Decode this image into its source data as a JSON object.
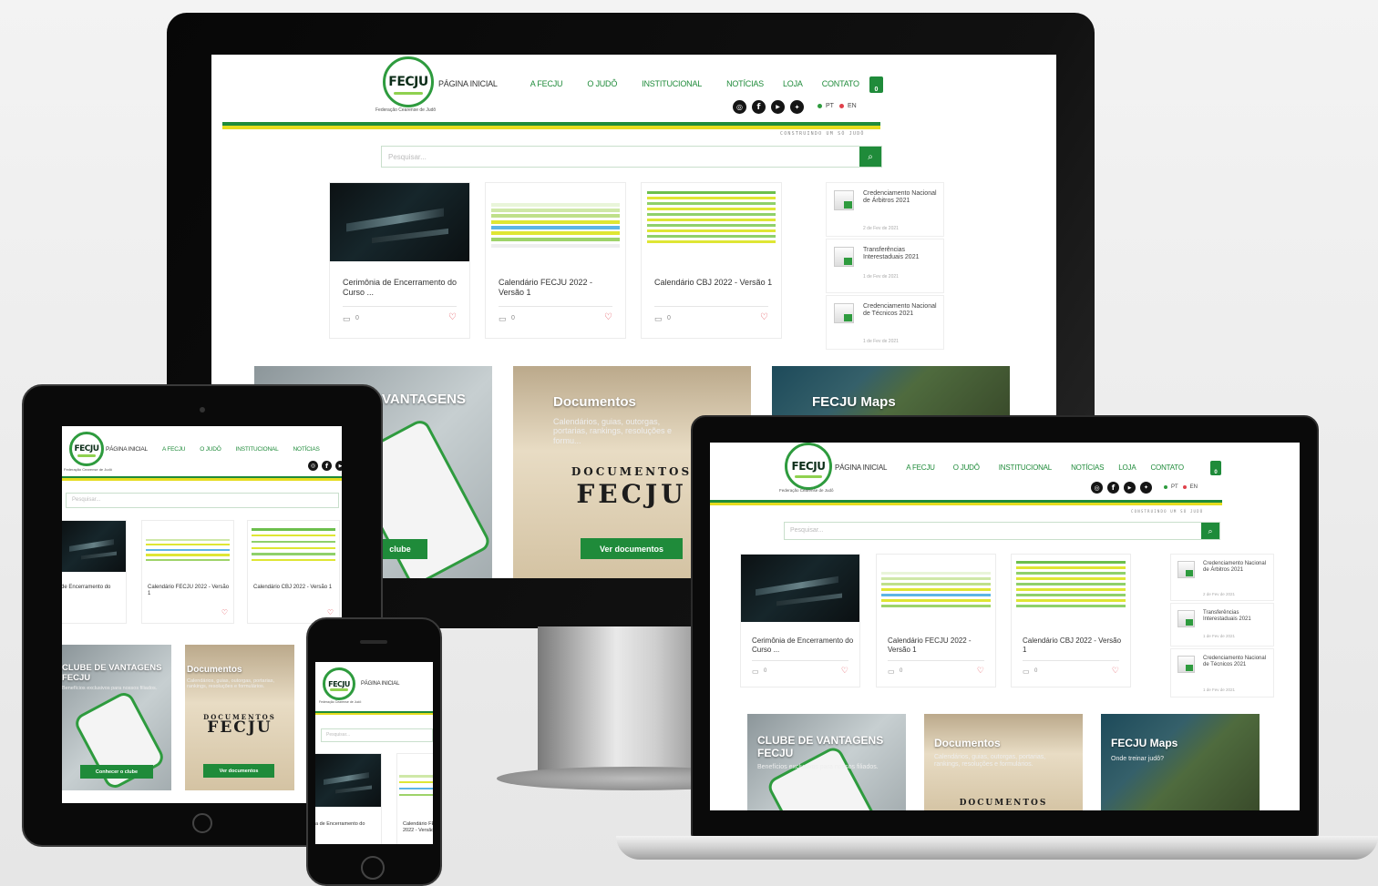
{
  "site": {
    "logo_text": "FECJU",
    "federation_name": "Federação Cearense de Judô",
    "nav": [
      "PÁGINA INICIAL",
      "A FECJU",
      "O JUDÔ",
      "INSTITUCIONAL",
      "NOTÍCIAS",
      "LOJA",
      "CONTATO"
    ],
    "cart_count": "0",
    "social_icons": [
      "instagram-icon",
      "facebook-icon",
      "youtube-icon",
      "twitter-icon"
    ],
    "languages": [
      {
        "code": "PT",
        "color": "#2e9b3e"
      },
      {
        "code": "EN",
        "color": "#e0414b"
      }
    ],
    "tagline": "CONSTRUINDO UM SÓ JUDÔ",
    "search_placeholder": "Pesquisar...",
    "posts": [
      {
        "title": "Cerimônia de Encerramento do Curso ...",
        "comments": "0"
      },
      {
        "title": "Calendário FECJU 2022 - Versão 1",
        "comments": "0"
      },
      {
        "title": "Calendário CBJ 2022 - Versão 1",
        "comments": "0"
      }
    ],
    "recent": [
      {
        "title": "Credenciamento Nacional de Árbitros 2021",
        "date": "2 de Fev de 2021"
      },
      {
        "title": "Transferências Interestaduais 2021",
        "date": "1 de Fev de 2021"
      },
      {
        "title": "Credenciamento Nacional de Técnicos 2021",
        "date": "1 de Fev de 2021"
      }
    ],
    "tiles": {
      "club": {
        "title_line1": "CLUBE DE VANTAGENS",
        "title_line2": "FECJU",
        "desc": "Benefícios exclusivos para nossos filiados.",
        "cta": "Conhecer o clube",
        "cta_short": "clube",
        "visible_fragment": "VANTAGENS"
      },
      "docs": {
        "title": "Documentos",
        "desc": "Calendários, guias, outorgas, portarias, rankings, resoluções e formulários.",
        "desc_short": "Calendários, guias, outorgas, portarias, rankings, resoluções e formu...",
        "cta": "Ver documentos",
        "stamp_line1": "DOCUMENTOS",
        "stamp_line2": "FECJU"
      },
      "map": {
        "title": "FECJU Maps",
        "desc": "Onde treinar judô?"
      }
    },
    "colors": {
      "brand_green": "#1f8b3a",
      "brand_yellow": "#e6dc1e",
      "heart_red": "#e0414b"
    }
  }
}
